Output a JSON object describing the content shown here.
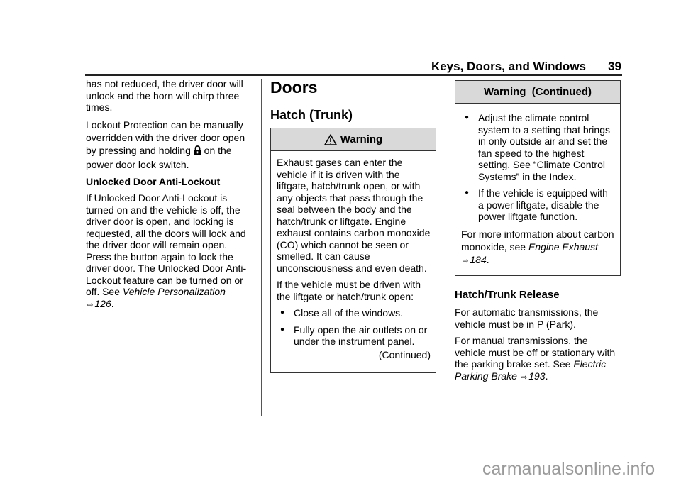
{
  "header": {
    "section_title": "Keys, Doors, and Windows",
    "page_number": "39"
  },
  "col1": {
    "p1": "has not reduced, the driver door will unlock and the horn will chirp three times.",
    "p2_line1": "Lockout Protection can be manually overridden with the driver door open",
    "p2_line2a": "by pressing and holding",
    "p2_icon": "lock-icon",
    "p2_line2b": "on the power door lock switch.",
    "subheading": "Unlocked Door Anti-Lockout",
    "p3": "If Unlocked Door Anti-Lockout is turned on and the vehicle is off, the driver door is open, and locking is requested, all the doors will lock and the driver door will remain open. Press the button again to lock the driver door. The Unlocked Door Anti-Lockout feature can be turned on or off. See",
    "p3_link": "Vehicle Personalization",
    "p3_arrow": "⇨",
    "p3_page": "126",
    "p3_end": "."
  },
  "col2": {
    "heading": "Doors",
    "subheading": "Hatch (Trunk)",
    "warning": {
      "icon": "warning-triangle-icon",
      "title": "Warning",
      "p1": "Exhaust gases can enter the vehicle if it is driven with the liftgate, hatch/trunk open, or with any objects that pass through the seal between the body and the hatch/trunk or liftgate. Engine exhaust contains carbon monoxide (CO) which cannot be seen or smelled. It can cause unconsciousness and even death.",
      "p2": "If the vehicle must be driven with the liftgate or hatch/trunk open:",
      "bullets": [
        "Close all of the windows.",
        "Fully open the air outlets on or under the instrument panel."
      ],
      "continued": "(Continued)"
    }
  },
  "col3": {
    "warning": {
      "title": "Warning  (Continued)",
      "bullets": [
        "Adjust the climate control system to a setting that brings in only outside air and set the fan speed to the highest setting. See “Climate Control Systems” in the Index.",
        "If the vehicle is equipped with a power liftgate, disable the power liftgate function."
      ],
      "p_more": "For more information about carbon monoxide, see",
      "p_more_link": "Engine Exhaust",
      "p_more_arrow": "⇨",
      "p_more_page": "184",
      "p_more_end": "."
    },
    "subheading": "Hatch/Trunk Release",
    "p1": "For automatic transmissions, the vehicle must be in P (Park).",
    "p2": "For manual transmissions, the vehicle must be off or stationary with the parking brake set. See",
    "p2_link": "Electric Parking Brake",
    "p2_arrow": "⇨",
    "p2_page": "193",
    "p2_end": "."
  },
  "watermark": "carmanualsonline.info"
}
